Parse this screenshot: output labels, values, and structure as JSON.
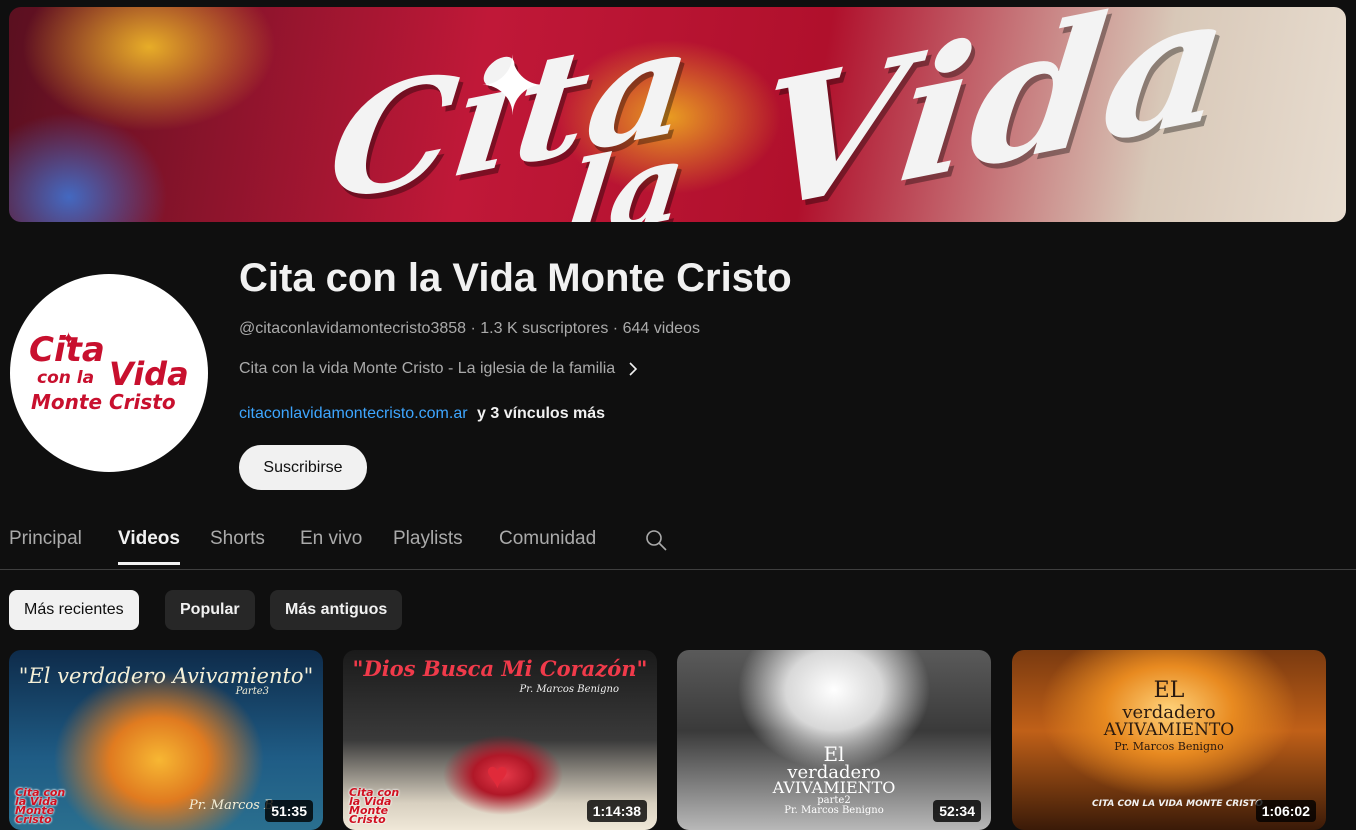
{
  "channel": {
    "name": "Cita con la Vida Monte Cristo",
    "handle": "@citaconlavidamontecristo3858",
    "separator": "·",
    "subscribers": "1.3 K suscriptores",
    "video_count": "644 videos",
    "description": "Cita con la vida Monte Cristo - La iglesia de la familia",
    "link": "citaconlavidamontecristo.com.ar",
    "more_links": "y 3 vínculos más",
    "subscribe_label": "Suscribirse",
    "avatar_logo": {
      "line1": "Cita",
      "line2": "con la",
      "line3": "Vida",
      "line4": "Monte Cristo"
    },
    "banner_text": {
      "word1": "Cita",
      "word2": "la",
      "word3": "Vida"
    }
  },
  "tabs": [
    {
      "label": "Principal",
      "active": false
    },
    {
      "label": "Videos",
      "active": true
    },
    {
      "label": "Shorts",
      "active": false
    },
    {
      "label": "En vivo",
      "active": false
    },
    {
      "label": "Playlists",
      "active": false
    },
    {
      "label": "Comunidad",
      "active": false
    }
  ],
  "filters": [
    {
      "label": "Más recientes",
      "active": true
    },
    {
      "label": "Popular",
      "active": false
    },
    {
      "label": "Más antiguos",
      "active": false
    }
  ],
  "videos": [
    {
      "thumb_title": "\"El verdadero Avivamiento\"",
      "thumb_part": "Parte3",
      "thumb_author": "Pr. Marcos B",
      "logo_text": "Cita con la Vida Monte Cristo",
      "duration": "51:35"
    },
    {
      "thumb_title": "\"Dios Busca Mi Corazón\"",
      "thumb_author": "Pr. Marcos Benigno",
      "logo_text": "Cita con la Vida Monte Cristo",
      "duration": "1:14:38"
    },
    {
      "thumb_title_1": "El",
      "thumb_title_2": "verdadero",
      "thumb_title_3": "AVIVAMIENTO",
      "thumb_part": "parte2",
      "thumb_author": "Pr. Marcos Benigno",
      "duration": "52:34"
    },
    {
      "thumb_title_1": "EL",
      "thumb_title_2": "verdadero",
      "thumb_title_3": "AVIVAMIENTO",
      "thumb_author": "Pr. Marcos Benigno",
      "footer_text": "CITA CON LA VIDA MONTE CRISTO",
      "duration": "1:06:02"
    }
  ],
  "colors": {
    "background": "#0f0f0f",
    "text_primary": "#f1f1f1",
    "text_secondary": "#aaaaaa",
    "link": "#3ea6ff",
    "brand_red": "#c8102e"
  },
  "icons": {
    "description_expand": "chevron-right-icon",
    "tab_search": "search-icon"
  }
}
